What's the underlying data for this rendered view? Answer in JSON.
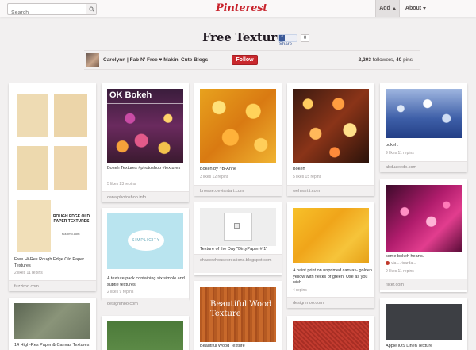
{
  "header": {
    "search_placeholder": "Search",
    "logo": "Pinterest",
    "nav": [
      {
        "label": "Add"
      },
      {
        "label": "About"
      }
    ]
  },
  "board": {
    "title": "Free Textures",
    "fb_share": "Share",
    "fb_count": "0",
    "owner": "Carolynn | Fab N' Free ♥ Makin' Cute Blogs",
    "follow": "Follow",
    "followers_count": "2,203",
    "followers_label": " followers, ",
    "pins_count": "40",
    "pins_label": " pins"
  },
  "pins": [
    {
      "desc": "Free Hi-Res Rough Edge Old Paper Textures",
      "meta": "2 likes   11 repins",
      "src": "fuzzimo.com",
      "img_text": "ROUGH EDGE OLD PAPER TEXTURES",
      "img_sub": "fuzzimo.com"
    },
    {
      "desc": "14 High-Res Paper & Canvas Textures"
    },
    {
      "desc": "Bokeh Textures #photoshop #textures",
      "meta": "5 likes   23 repins",
      "src": "canalphotoshop.info",
      "img_text": "OK Bokeh"
    },
    {
      "desc": "A texture pack containing six simple and subtle textures.",
      "meta": "2 likes   9 repins",
      "src": "designmoo.com",
      "img_text": "SIMPLICITY"
    },
    {
      "desc": "Bokeh by ~B-Anne",
      "meta": "3 likes   12 repins",
      "src": "browse.deviantart.com"
    },
    {
      "desc": "Texture of the Day \"DirtyPaper # 1\"",
      "src": "shadowhousecreations.blogspot.com"
    },
    {
      "desc": "Beautiful Wood Texture",
      "img_text": "Beautiful Wood Texture"
    },
    {
      "desc": "Bokeh",
      "meta": "5 likes   15 repins",
      "src": "weheartit.com"
    },
    {
      "desc": "A paint print on unprimed canvas- golden yellow with flecks of green. Use as you wish.",
      "meta": "4 repins",
      "src": "designmoo.com"
    },
    {
      "desc": "bokeh.",
      "meta": "9 likes   11 repins",
      "src": "abduzeedo.com"
    },
    {
      "desc": "some bokeh hearts.",
      "via": "via ...ricarda...",
      "meta": "9 likes   11 repins",
      "src": "flickr.com"
    },
    {
      "desc": "Apple iOS Linen Texture"
    }
  ],
  "colors": {
    "brand": "#c8232c",
    "follow": "#c9282d",
    "background": "#f2f0f0"
  }
}
